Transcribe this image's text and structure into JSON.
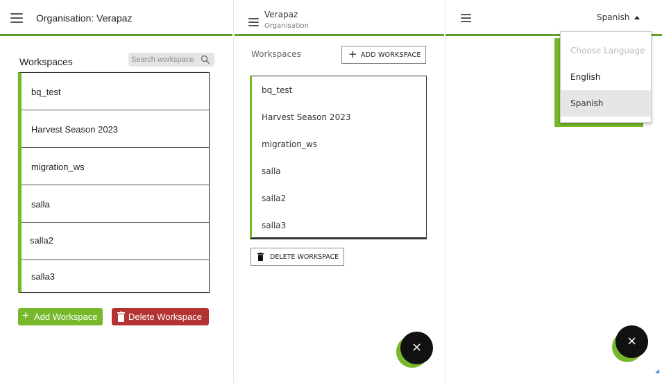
{
  "panel1": {
    "title": "Organisation: Verapaz",
    "workspaces_heading": "Workspaces",
    "search_placeholder": "Search workspace",
    "items": [
      {
        "label": "bq_test"
      },
      {
        "label": "Harvest Season 2023"
      },
      {
        "label": "migration_ws"
      },
      {
        "label": "salla"
      },
      {
        "label": "salla2"
      },
      {
        "label": "salla3"
      }
    ],
    "add_button": "Add Workspace",
    "add_symbol": "+",
    "delete_button": "Delete Workspace",
    "colors": {
      "accent": "#76b82a",
      "danger": "#b33232"
    }
  },
  "panel2": {
    "title": "Verapaz",
    "subtitle": "Organisation",
    "workspaces_heading": "Workspaces",
    "add_button": "ADD WORKSPACE",
    "add_symbol": "+",
    "items": [
      {
        "label": "bq_test"
      },
      {
        "label": "Harvest Season 2023"
      },
      {
        "label": "migration_ws"
      },
      {
        "label": "salla"
      },
      {
        "label": "salla2"
      },
      {
        "label": "salla3"
      }
    ],
    "delete_button": "DELETE WORKSPACE",
    "fab_symbol": "×"
  },
  "panel3": {
    "current_language": "Spanish",
    "menu": {
      "placeholder": "Choose Language",
      "options": [
        {
          "label": "English",
          "selected": false
        },
        {
          "label": "Spanish",
          "selected": true
        }
      ]
    },
    "fab_symbol": "×",
    "colors": {
      "accent": "#76b82a",
      "fab": "#111111"
    }
  }
}
